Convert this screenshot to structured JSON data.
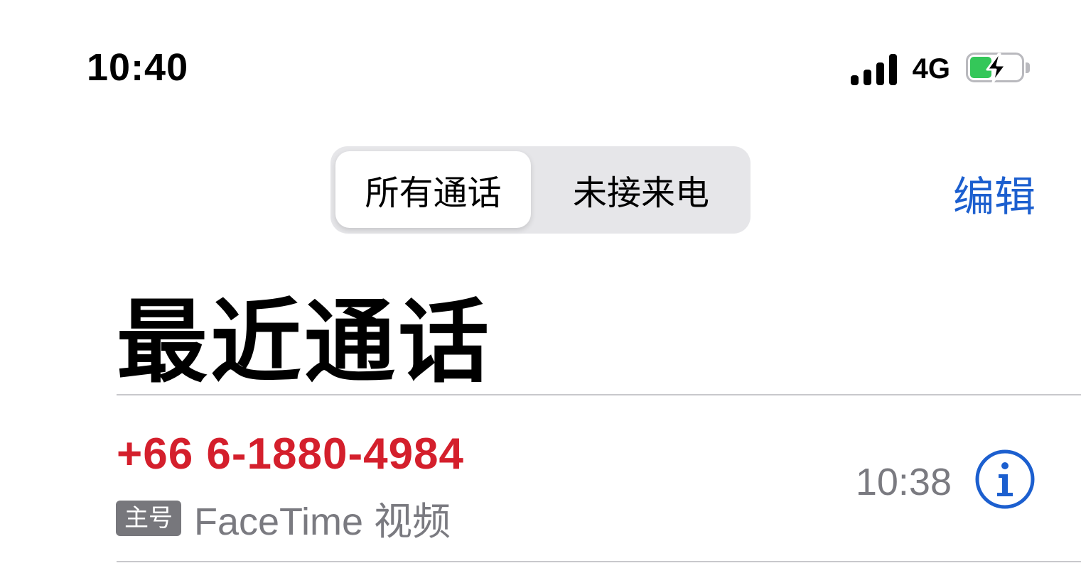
{
  "status_bar": {
    "time": "10:40",
    "network": "4G",
    "icons": [
      "signal-icon",
      "battery-charging-icon"
    ]
  },
  "segmented_control": {
    "all_calls_label": "所有通话",
    "missed_label": "未接来电"
  },
  "nav": {
    "edit_label": "编辑"
  },
  "title": "最近通话",
  "calls": [
    {
      "number": "+66 6-1880-4984",
      "badge": "主号",
      "type": "FaceTime 视频",
      "time": "10:38"
    }
  ],
  "colors": {
    "accent": "#1c5fcf",
    "missed_red": "#d41f2c",
    "battery_green": "#34c759",
    "segment_bg": "#e6e6e9"
  }
}
